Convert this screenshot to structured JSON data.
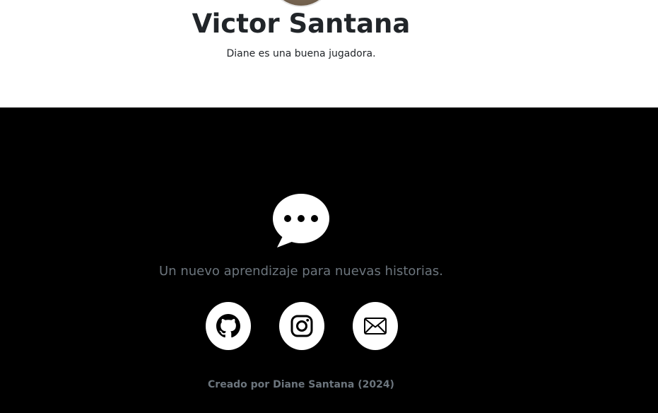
{
  "profile": {
    "name": "Victor Santana",
    "description": "Diane es una buena jugadora."
  },
  "footer": {
    "logo_icon": "chat-bubble-dots-icon",
    "tagline": "Un nuevo aprendizaje para nuevas historias.",
    "social": [
      {
        "icon": "github-icon"
      },
      {
        "icon": "instagram-icon"
      },
      {
        "icon": "envelope-icon"
      }
    ],
    "credit": "Creado por Diane Santana (2024)"
  },
  "colors": {
    "footer_background": "#000000",
    "muted_text": "#6c757d",
    "heading_text": "#212529",
    "button_background": "#ffffff"
  }
}
